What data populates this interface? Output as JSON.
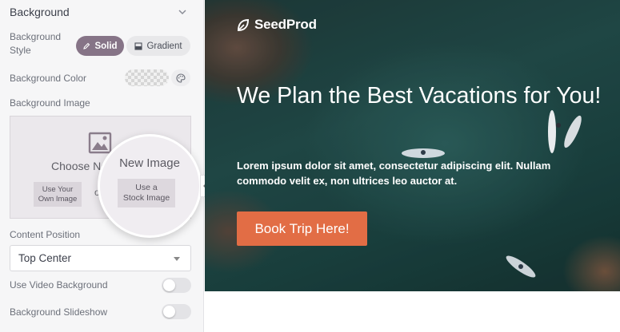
{
  "panel": {
    "section_title": "Background",
    "background_style": {
      "label_line1": "Background",
      "label_line2": "Style",
      "options": [
        "Solid",
        "Gradient"
      ],
      "selected": "Solid"
    },
    "background_color": {
      "label": "Background Color"
    },
    "background_image": {
      "label": "Background Image",
      "choose_text": "Choose New Image",
      "own_image_line1": "Use Your",
      "own_image_line2": "Own Image",
      "or_text": "or",
      "stock_image_line1": "Use a",
      "stock_image_line2": "Stock Image"
    },
    "content_position": {
      "label": "Content Position",
      "value": "Top Center"
    },
    "video_background": {
      "label": "Use Video Background",
      "on": false
    },
    "slideshow": {
      "label": "Background Slideshow",
      "on": false
    }
  },
  "hero": {
    "logo": "SeedProd",
    "headline": "We Plan the Best Vacations for You!",
    "subtext": "Lorem ipsum dolor sit amet, consectetur adipiscing elit. Nullam commodo velit ex, non ultrices leo auctor at.",
    "cta": "Book Trip Here!"
  },
  "colors": {
    "accent": "#867487",
    "cta": "#e26d45",
    "panel_bg": "#f6f6f7"
  }
}
